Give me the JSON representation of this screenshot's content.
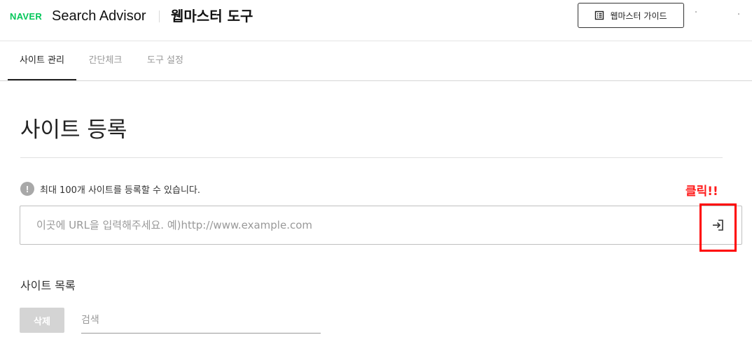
{
  "header": {
    "brand": "NAVER",
    "product": "Search Advisor",
    "tool_title": "웹마스터 도구",
    "guide_button": "웹마스터 가이드"
  },
  "tabs": [
    {
      "label": "사이트 관리",
      "active": true
    },
    {
      "label": "간단체크",
      "active": false
    },
    {
      "label": "도구 설정",
      "active": false
    }
  ],
  "main": {
    "page_title": "사이트 등록",
    "notice_icon": "!",
    "notice": "최대 100개 사이트를 등록할 수 있습니다.",
    "url_input": {
      "placeholder": "이곳에 URL을 입력해주세요. 예)http://www.example.com",
      "value": ""
    },
    "annotation": "클릭!!",
    "site_list_title": "사이트 목록",
    "delete_button": "삭제",
    "search_placeholder": "검색"
  },
  "colors": {
    "brand_green": "#03c75a",
    "annotation_red": "#ff0000",
    "disabled_button": "#d4d4d4",
    "notice_icon_gray": "#a8a8a8"
  },
  "icons": {
    "guide": "book-list-icon",
    "notice": "exclamation-circle-icon",
    "submit": "sign-in-arrow-icon"
  }
}
